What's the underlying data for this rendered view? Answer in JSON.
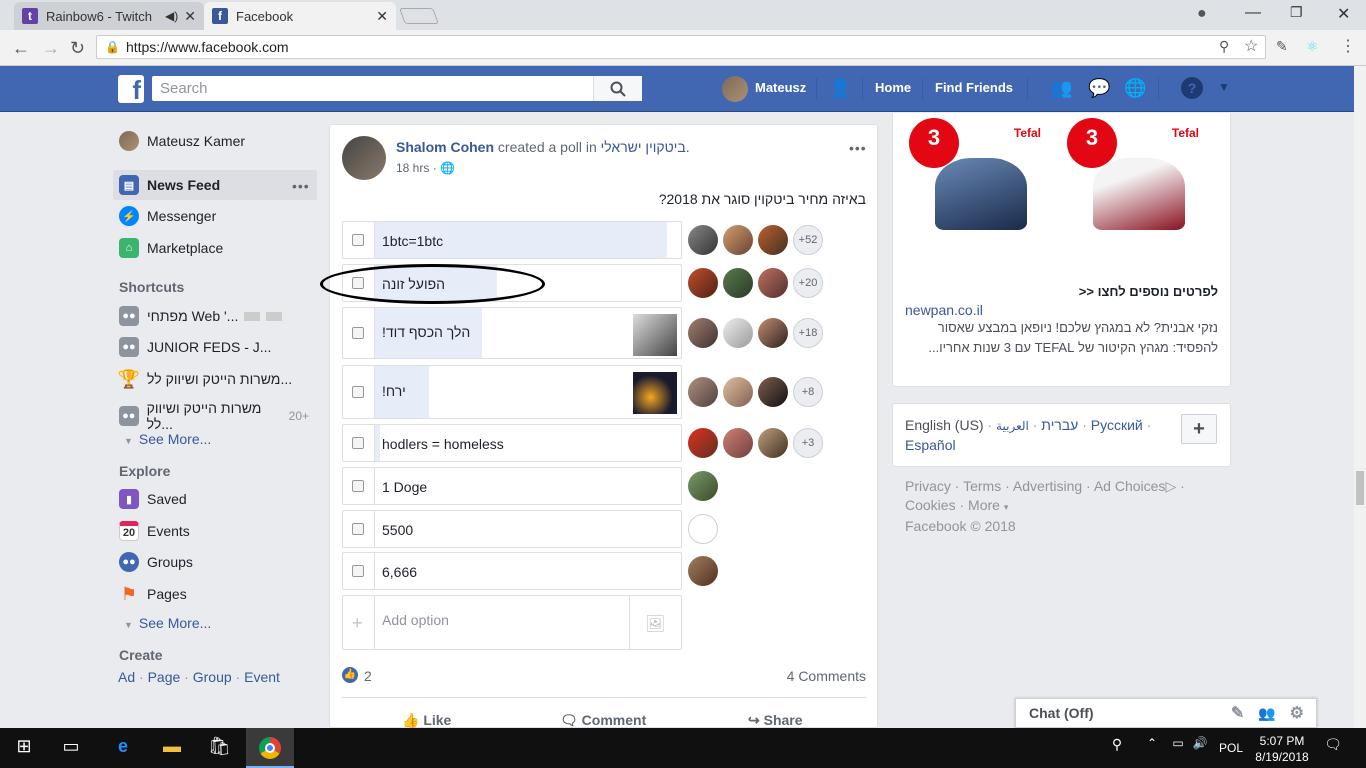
{
  "browser": {
    "tabs": [
      {
        "label": "Rainbow6 - Twitch",
        "icon": "twitch-icon",
        "color": "#6441a4"
      },
      {
        "label": "Facebook",
        "icon": "facebook-icon",
        "color": "#3b5998"
      }
    ],
    "url": "https://www.facebook.com"
  },
  "header": {
    "search_placeholder": "Search",
    "user_name": "Mateusz",
    "home": "Home",
    "find_friends": "Find Friends"
  },
  "left": {
    "profile_name": "Mateusz Kamer",
    "nav": [
      "News Feed",
      "Messenger",
      "Marketplace"
    ],
    "shortcuts_title": "Shortcuts",
    "shortcuts": [
      {
        "label": "מפתחי Web '..."
      },
      {
        "label": "JUNIOR FEDS - J..."
      },
      {
        "label": "משרות הייטק ושיווק לל..."
      },
      {
        "label": "משרות הייטק ושיווק לל...",
        "badge": "20+"
      }
    ],
    "see_more": "See More...",
    "explore_title": "Explore",
    "explore": [
      "Saved",
      "Events",
      "Groups",
      "Pages"
    ],
    "events_day": "20",
    "create_title": "Create",
    "create": [
      "Ad",
      "Page",
      "Group",
      "Event"
    ]
  },
  "post": {
    "author": "Shalom Cohen",
    "action": "created a poll in",
    "group": "ביטקוין ישראלי.",
    "time": "18 hrs",
    "question": "באיזה מחיר ביטקוין סוגר את 2018?",
    "options": [
      {
        "text": "1btc=1btc",
        "fill": 0.95,
        "more": "+52"
      },
      {
        "text": "הפועל זונה",
        "fill": 0.4,
        "more": "+20"
      },
      {
        "text": "הלך הכסף דוד!",
        "fill": 0.35,
        "more": "+18"
      },
      {
        "text": "ירח!",
        "fill": 0.18,
        "more": "+8"
      },
      {
        "text": "hodlers = homeless",
        "fill": 0.02,
        "more": "+3"
      },
      {
        "text": "1 Doge",
        "fill": 0.01,
        "more": ""
      },
      {
        "text": "5500",
        "fill": 0.01,
        "more": ""
      },
      {
        "text": "6,666",
        "fill": 0.01,
        "more": ""
      }
    ],
    "add_option": "Add option",
    "likes": "2",
    "comments": "4 Comments",
    "actions": [
      "Like",
      "Comment",
      "Share"
    ]
  },
  "ad": {
    "brand": "Tefal",
    "badge": "3",
    "cta": "לפרטים נוספים לחצו <<",
    "domain": "newpan.co.il",
    "text1": "נזקי אבנית? לא במגהץ שלכם! ניופאן במבצע שאסור",
    "text2": "להפסיד: מגהץ הקיטור של TEFAL עם 3 שנות אחריו..."
  },
  "languages": {
    "current": "English (US)",
    "others": [
      "עברית",
      "العربية",
      "Русский"
    ],
    "espanol": "Español"
  },
  "footer": {
    "links": [
      "Privacy",
      "Terms",
      "Advertising",
      "Ad Choices"
    ],
    "cookies": "Cookies",
    "more": "More",
    "copyright": "Facebook © 2018"
  },
  "chat": {
    "label": "Chat (Off)"
  },
  "taskbar": {
    "lang": "POL",
    "time": "5:07 PM",
    "date": "8/19/2018"
  }
}
